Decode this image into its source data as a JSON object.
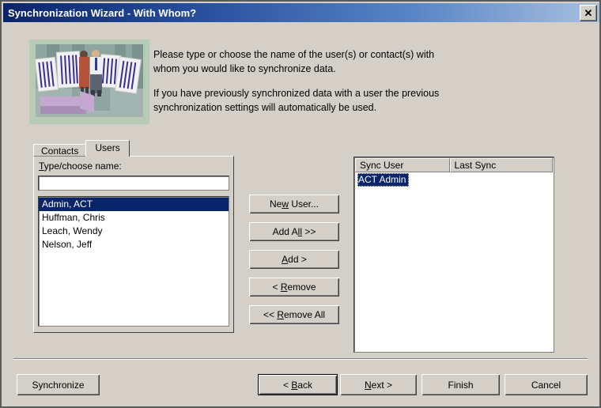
{
  "window": {
    "title": "Synchronization Wizard - With Whom?",
    "close_label": "✕",
    "titlebar_gradient_start": "#0a246a",
    "titlebar_gradient_end": "#a8c0e0",
    "face_color": "#d4d0c8",
    "selection_color": "#0a246a"
  },
  "illustration": {
    "alt": "two-people-with-documents-illustration",
    "background": "#b8cbb4"
  },
  "instructions": {
    "paragraph1": "Please type or choose the name of the user(s) or contact(s) with whom you would like to synchronize data.",
    "paragraph2": "If you have previously synchronized data with a user the previous synchronization settings will automatically be used."
  },
  "tabs": [
    {
      "label": "Contacts",
      "active": false
    },
    {
      "label": "Users",
      "active": true
    }
  ],
  "left_panel": {
    "label_prefix": "T",
    "label_rest": "ype/choose name:",
    "input_value": "",
    "input_placeholder": "",
    "users": [
      {
        "name": "Admin, ACT",
        "selected": true
      },
      {
        "name": "Huffman, Chris",
        "selected": false
      },
      {
        "name": "Leach, Wendy",
        "selected": false
      },
      {
        "name": "Nelson, Jeff",
        "selected": false
      }
    ]
  },
  "transfer_buttons": [
    {
      "pre": "Ne",
      "key": "w",
      "post": " User..."
    },
    {
      "pre": "Add A",
      "key": "ll",
      "post": " >>"
    },
    {
      "pre": "",
      "key": "A",
      "post": "dd >"
    },
    {
      "pre": "< ",
      "key": "R",
      "post": "emove"
    },
    {
      "pre": "<< ",
      "key": "R",
      "post": "emove All"
    }
  ],
  "sync_list": {
    "columns": [
      "Sync User",
      "Last Sync"
    ],
    "rows": [
      {
        "sync_user": "ACT Admin",
        "last_sync": "",
        "selected": true
      }
    ]
  },
  "bottom_buttons": {
    "synchronize": {
      "pre": "",
      "key": "",
      "post": "Synchronize"
    },
    "back": {
      "pre": "< ",
      "key": "B",
      "post": "ack"
    },
    "next": {
      "pre": "",
      "key": "N",
      "post": "ext >"
    },
    "finish": {
      "pre": "",
      "key": "",
      "post": "Finish"
    },
    "cancel": {
      "pre": "",
      "key": "",
      "post": "Cancel"
    }
  }
}
